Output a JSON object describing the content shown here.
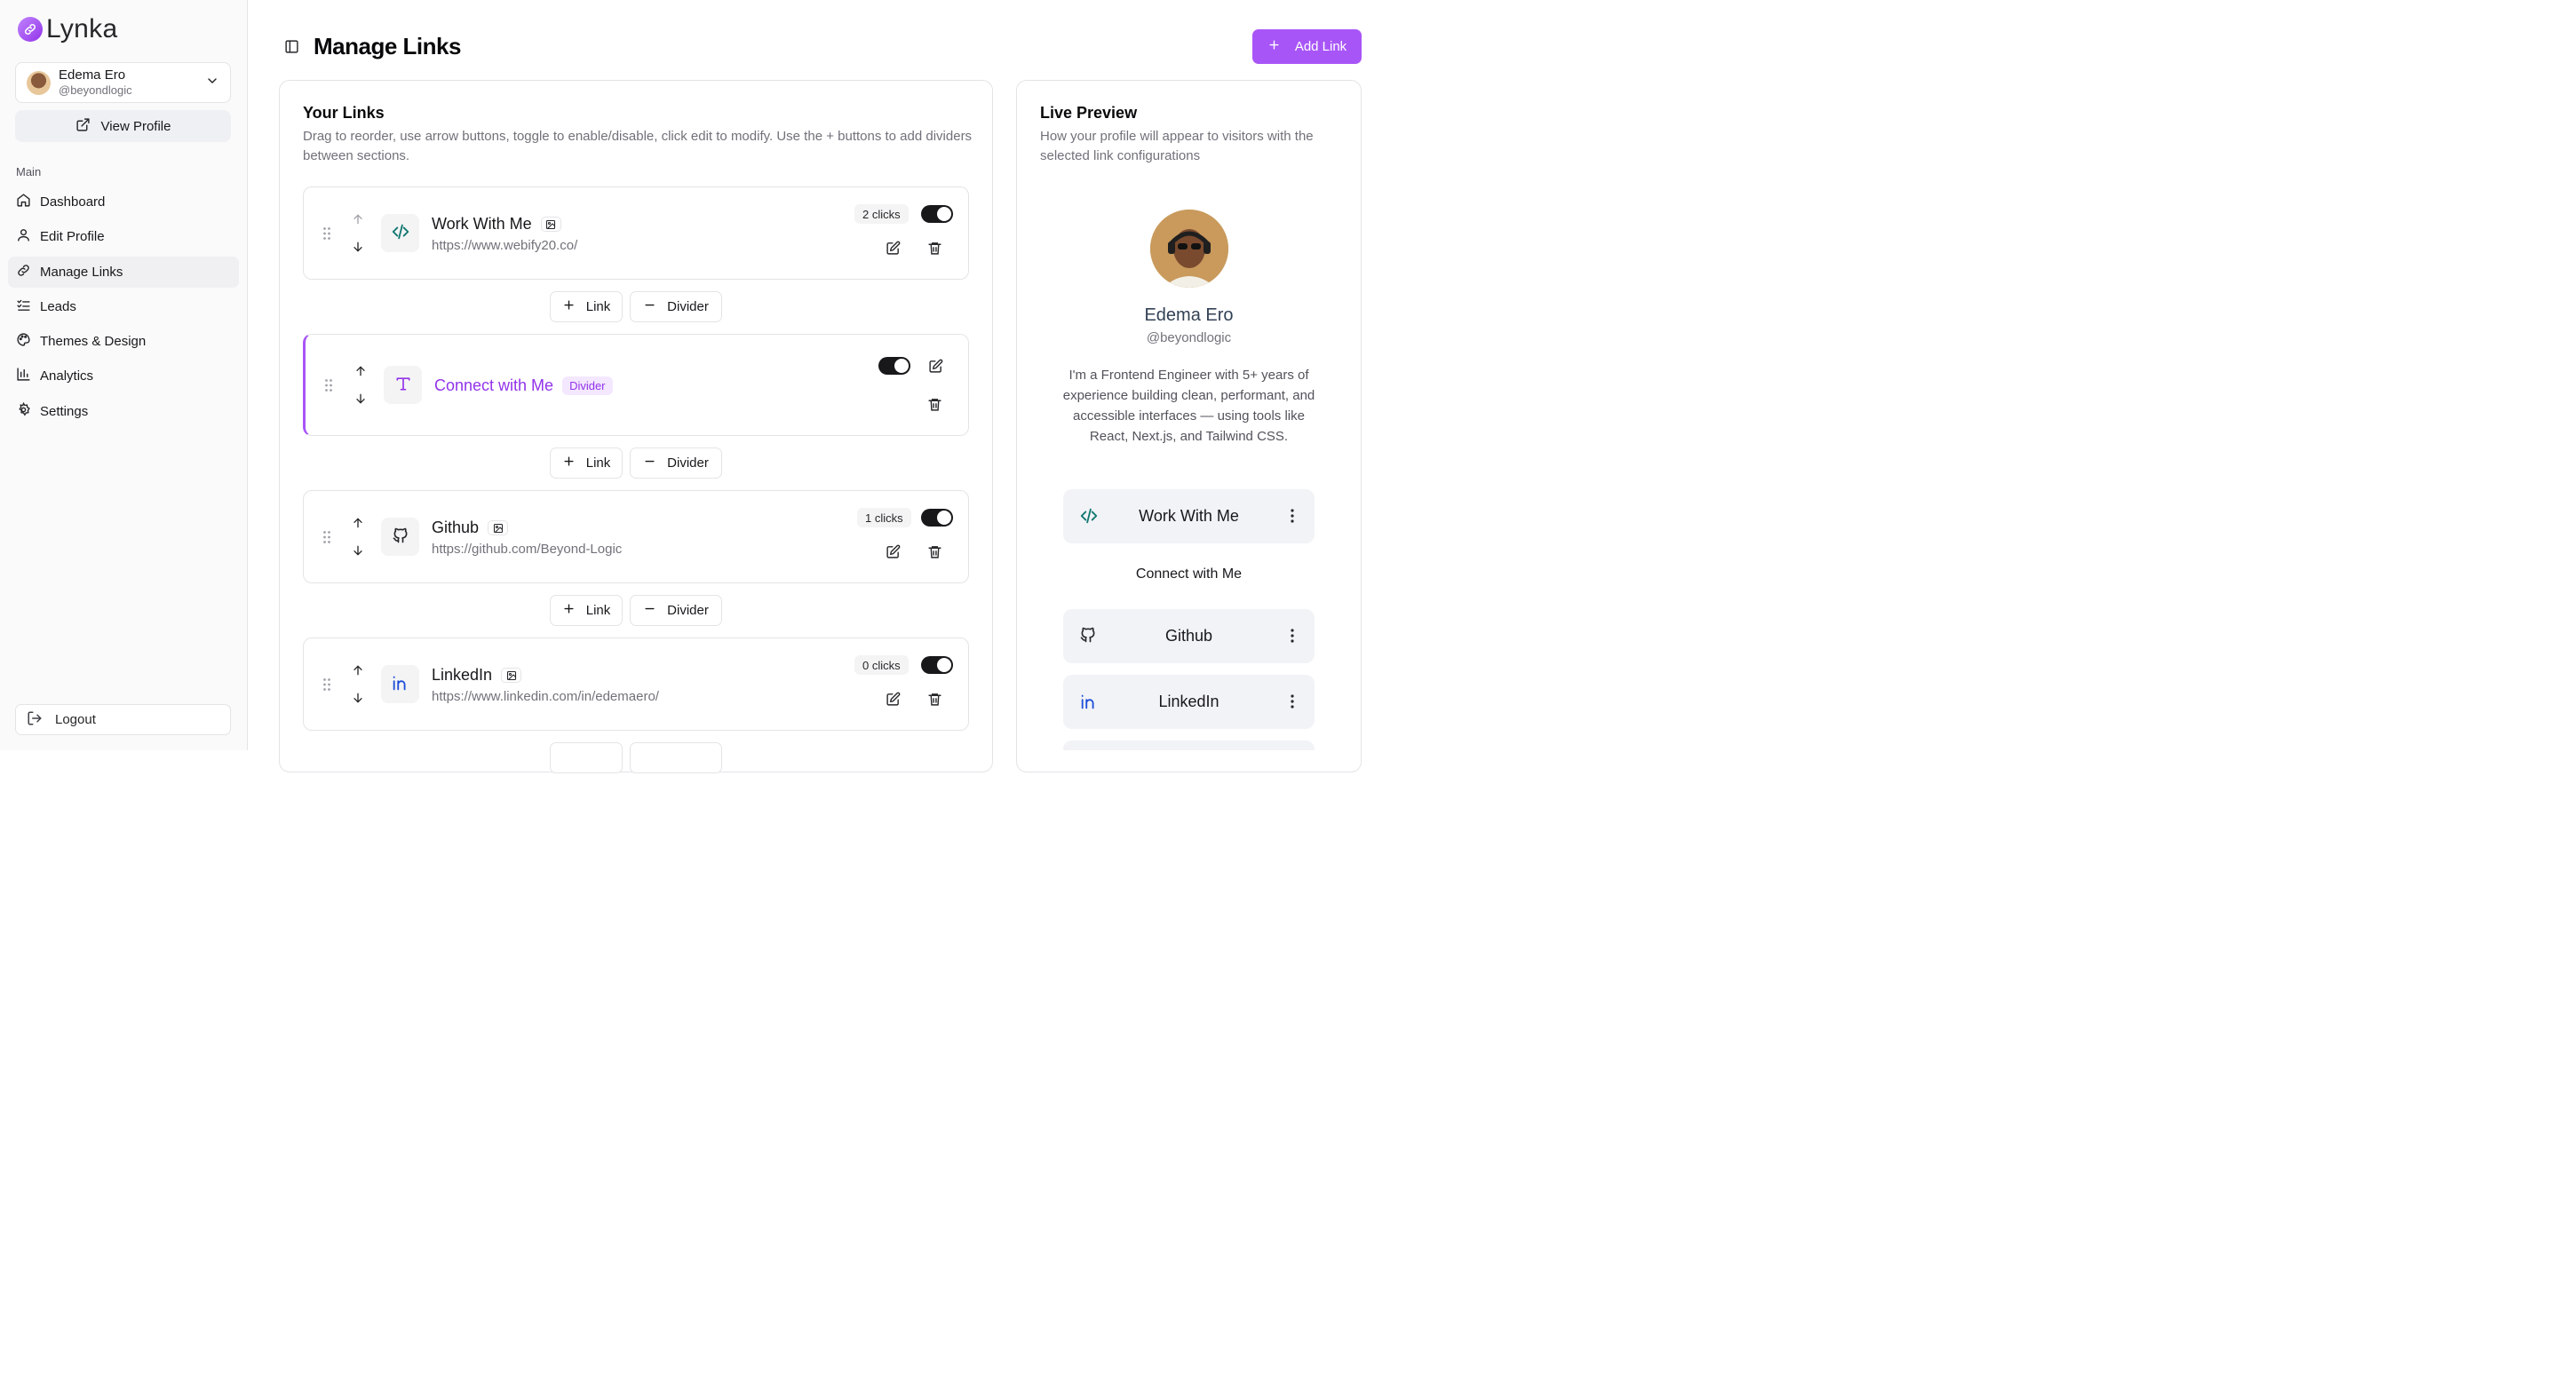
{
  "app": {
    "name": "Lynka"
  },
  "user": {
    "name": "Edema Ero",
    "handle": "@beyondlogic"
  },
  "sidebar": {
    "view_profile": "View Profile",
    "section": "Main",
    "items": [
      {
        "label": "Dashboard",
        "icon": "home-icon"
      },
      {
        "label": "Edit Profile",
        "icon": "user-icon"
      },
      {
        "label": "Manage Links",
        "icon": "link-icon"
      },
      {
        "label": "Leads",
        "icon": "list-check-icon"
      },
      {
        "label": "Themes & Design",
        "icon": "palette-icon"
      },
      {
        "label": "Analytics",
        "icon": "bar-chart-icon"
      },
      {
        "label": "Settings",
        "icon": "gear-icon"
      }
    ],
    "logout": "Logout"
  },
  "header": {
    "title": "Manage Links",
    "add_link": "Add Link"
  },
  "links_panel": {
    "title": "Your Links",
    "description": "Drag to reorder, use arrow buttons, toggle to enable/disable, click edit to modify. Use the + buttons to add dividers between sections.",
    "add_link_label": "Link",
    "add_divider_label": "Divider",
    "rows": [
      {
        "title": "Work With Me",
        "url": "https://www.webify20.co/",
        "clicks": "2 clicks",
        "icon": "code-icon"
      },
      {
        "title": "Connect with Me",
        "badge": "Divider",
        "icon": "text-t-icon"
      },
      {
        "title": "Github",
        "url": "https://github.com/Beyond-Logic",
        "clicks": "1 clicks",
        "icon": "github-icon"
      },
      {
        "title": "LinkedIn",
        "url": "https://www.linkedin.com/in/edemaero/",
        "clicks": "0 clicks",
        "icon": "linkedin-icon"
      }
    ]
  },
  "preview": {
    "title": "Live Preview",
    "description": "How your profile will appear to visitors with the selected link configurations",
    "name": "Edema Ero",
    "handle": "@beyondlogic",
    "bio": "I'm a Frontend Engineer with 5+ years of experience building clean, performant, and accessible interfaces — using tools like React, Next.js, and Tailwind CSS.",
    "links": [
      {
        "title": "Work With Me",
        "icon": "code-icon"
      },
      {
        "title": "Github",
        "icon": "github-icon"
      },
      {
        "title": "LinkedIn",
        "icon": "linkedin-icon"
      }
    ],
    "divider": "Connect with Me"
  },
  "colors": {
    "accent": "#a855f7",
    "accent_text": "#9333ea",
    "toggle_on": "#18181b"
  }
}
